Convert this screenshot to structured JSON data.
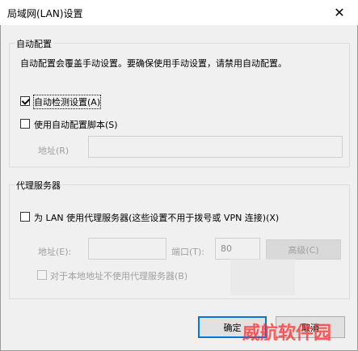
{
  "window": {
    "title": "局域网(LAN)设置",
    "close_glyph": "✕"
  },
  "auto_config": {
    "group_label": "自动配置",
    "description": "自动配置会覆盖手动设置。要确保使用手动设置，请禁用自动配置。",
    "auto_detect": {
      "label": "自动检测设置(A)",
      "checked": true
    },
    "use_script": {
      "label": "使用自动配置脚本(S)",
      "checked": false
    },
    "address_label": "地址(R)",
    "address_value": ""
  },
  "proxy": {
    "group_label": "代理服务器",
    "use_proxy": {
      "label": "为 LAN 使用代理服务器(这些设置不用于拨号或 VPN 连接)(X)",
      "checked": false
    },
    "address_label": "地址(E):",
    "address_value": "",
    "port_label": "端口(T):",
    "port_value": "80",
    "advanced_label": "高级(C)",
    "bypass_local": {
      "label": "对于本地地址不使用代理服务器(B)",
      "checked": false
    }
  },
  "buttons": {
    "ok_label": "确定",
    "cancel_label": "取消"
  },
  "watermark": "威航软件园",
  "colors": {
    "accent": "#0078d7",
    "watermark": "#ff2a2a",
    "disabled_text": "#a0a0a0"
  }
}
